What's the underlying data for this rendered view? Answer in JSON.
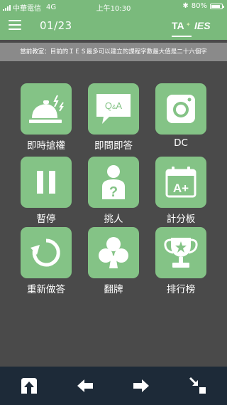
{
  "status_bar": {
    "carrier": "中華電信",
    "network": "4G",
    "time": "上午10:30",
    "battery": "80%",
    "battery_level": 0.8
  },
  "navbar": {
    "page_indicator": "01/23",
    "brand_ta": "TA",
    "brand_ies": "IES"
  },
  "notice": "當前教室：目前的ＩＥＳ最多可以建立的課程字數最大值是二十六個字",
  "tools": [
    {
      "label": "即時搶權",
      "icon": "service-bell-icon"
    },
    {
      "label": "即問即答",
      "icon": "qa-bubble-icon"
    },
    {
      "label": "DC",
      "icon": "camera-icon"
    },
    {
      "label": "暫停",
      "icon": "pause-icon"
    },
    {
      "label": "挑人",
      "icon": "person-question-icon"
    },
    {
      "label": "計分板",
      "icon": "calendar-grade-icon"
    },
    {
      "label": "重新做答",
      "icon": "refresh-icon"
    },
    {
      "label": "翻牌",
      "icon": "club-card-icon"
    },
    {
      "label": "排行榜",
      "icon": "trophy-icon"
    }
  ],
  "bottom_bar": {
    "icons": [
      "upload-icon",
      "arrow-left-icon",
      "arrow-right-icon",
      "shrink-icon"
    ]
  },
  "colors": {
    "header": "#7aba7c",
    "tile": "#84c386",
    "background": "#4a4a4a",
    "bottom_bar": "#1d2a38"
  }
}
